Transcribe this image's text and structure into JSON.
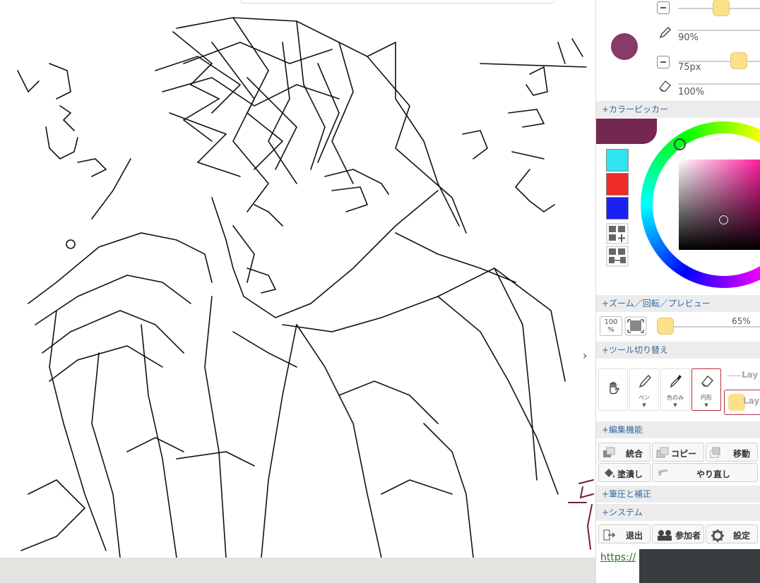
{
  "brush": {
    "opacity_label": "90%",
    "size_label": "75px",
    "eraser_opacity_label": "100%",
    "current_color": "#883a68"
  },
  "sections": {
    "color_picker": "+カラーピッカー",
    "zoom": "+ズーム／回転／プレビュー",
    "tool_switch": "+ツール切り替え",
    "edit": "+編集機能",
    "pressure": "+筆圧と補正",
    "system": "+システム"
  },
  "palette": {
    "swatches": [
      "#30e3ef",
      "#ee2b24",
      "#1a20f0"
    ],
    "header_color": "#74284f"
  },
  "zoom": {
    "reset_label": "100\n%",
    "percent_label": "65%",
    "level": 0.65
  },
  "tools": {
    "hand": "",
    "pen": "ペン",
    "eyedropper": "色のみ",
    "eraser": "円形",
    "layer_label": "Lay"
  },
  "edit_buttons": {
    "merge": "統合",
    "copy": "コピー",
    "move": "移動",
    "fill": "塗潰し",
    "redo": "やり直し"
  },
  "system_buttons": {
    "exit": "退出",
    "participants": "参加者",
    "settings": "設定"
  },
  "footer": {
    "url": "https://"
  },
  "canvas": {
    "collapse_arrow": "›"
  }
}
